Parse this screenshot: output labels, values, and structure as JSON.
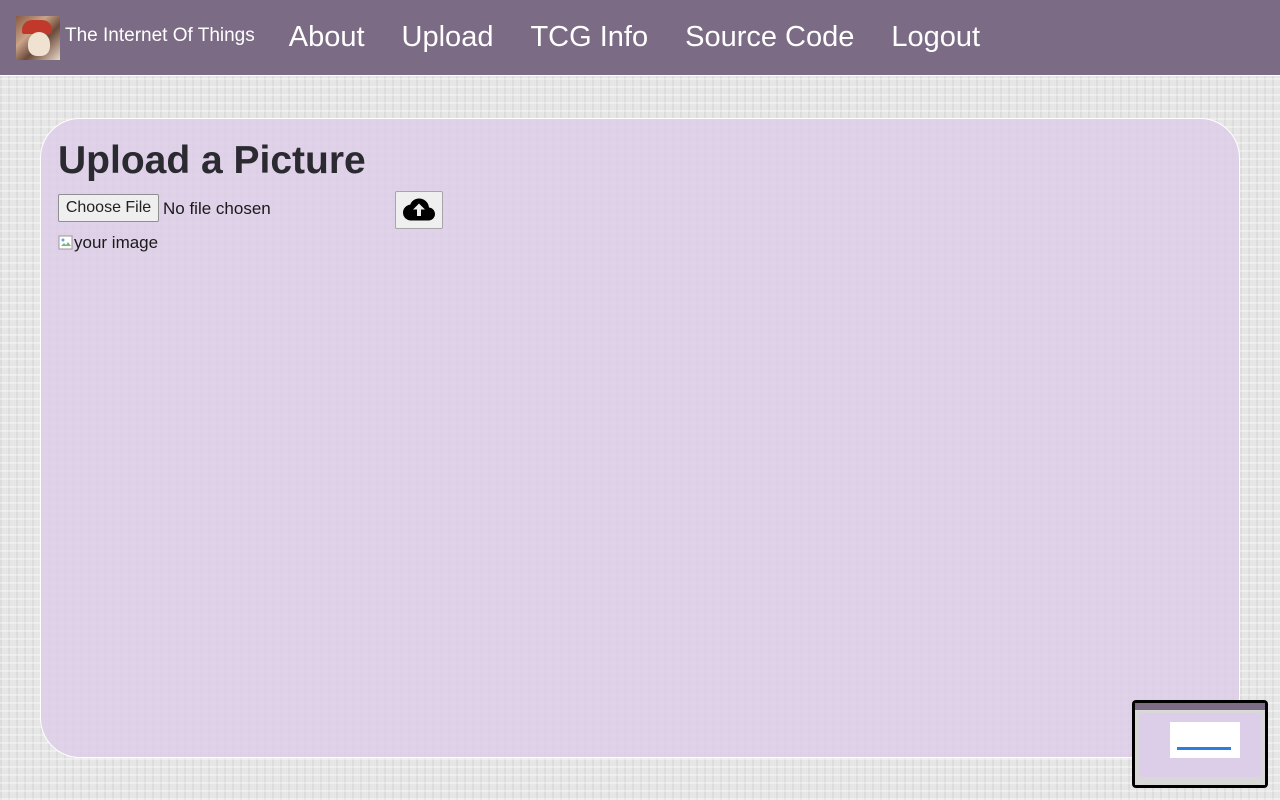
{
  "nav": {
    "brand": "The Internet Of Things",
    "links": [
      "About",
      "Upload",
      "TCG Info",
      "Source Code",
      "Logout"
    ]
  },
  "main": {
    "title": "Upload a Picture",
    "file_button": "Choose File",
    "file_status": "No file chosen",
    "image_alt": "your image"
  },
  "icons": {
    "upload": "cloud-upload-icon",
    "logo": "brand-logo"
  },
  "colors": {
    "navbar": "#7b6b85",
    "card": "#dccde8"
  }
}
